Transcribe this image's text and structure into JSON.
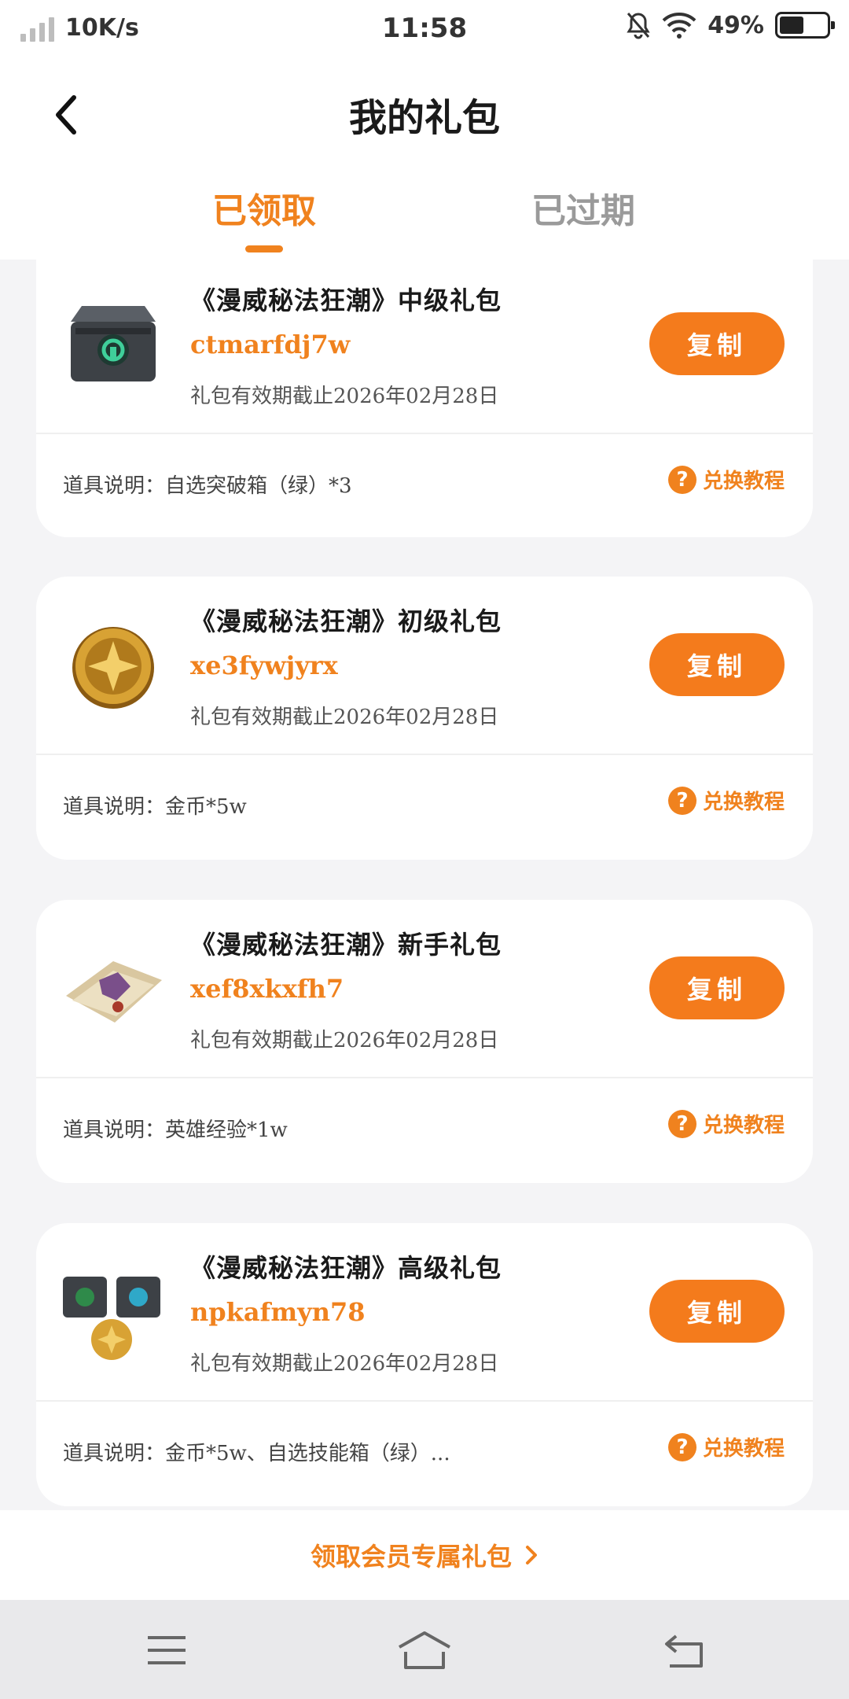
{
  "status_bar": {
    "network_speed": "10K/s",
    "time": "11:58",
    "battery": "49%"
  },
  "header": {
    "title": "我的礼包",
    "tabs": [
      {
        "label": "已领取",
        "active": true
      },
      {
        "label": "已过期",
        "active": false
      }
    ]
  },
  "gifts": [
    {
      "name": "《漫威秘法狂潮》中级礼包",
      "code": "ctmarfdj7w",
      "expiry": "礼包有效期截止2026年02月28日",
      "copy_label": "复制",
      "description": "道具说明：自选突破箱（绿）*3",
      "help_label": "兑换教程",
      "icon": "chest-icon"
    },
    {
      "name": "《漫威秘法狂潮》初级礼包",
      "code": "xe3fywjyrx",
      "expiry": "礼包有效期截止2026年02月28日",
      "copy_label": "复制",
      "description": "道具说明：金币*5w",
      "help_label": "兑换教程",
      "icon": "coin-icon"
    },
    {
      "name": "《漫威秘法狂潮》新手礼包",
      "code": "xef8xkxfh7",
      "expiry": "礼包有效期截止2026年02月28日",
      "copy_label": "复制",
      "description": "道具说明：英雄经验*1w",
      "help_label": "兑换教程",
      "icon": "scroll-icon"
    },
    {
      "name": "《漫威秘法狂潮》高级礼包",
      "code": "npkafmyn78",
      "expiry": "礼包有效期截止2026年02月28日",
      "copy_label": "复制",
      "description": "道具说明：金币*5w、自选技能箱（绿）...",
      "help_label": "兑换教程",
      "icon": "bundle-icon"
    }
  ],
  "member_link": {
    "label": "领取会员专属礼包"
  },
  "colors": {
    "accent": "#f0821e",
    "button": "#f47b1c",
    "background": "#f4f4f6"
  }
}
